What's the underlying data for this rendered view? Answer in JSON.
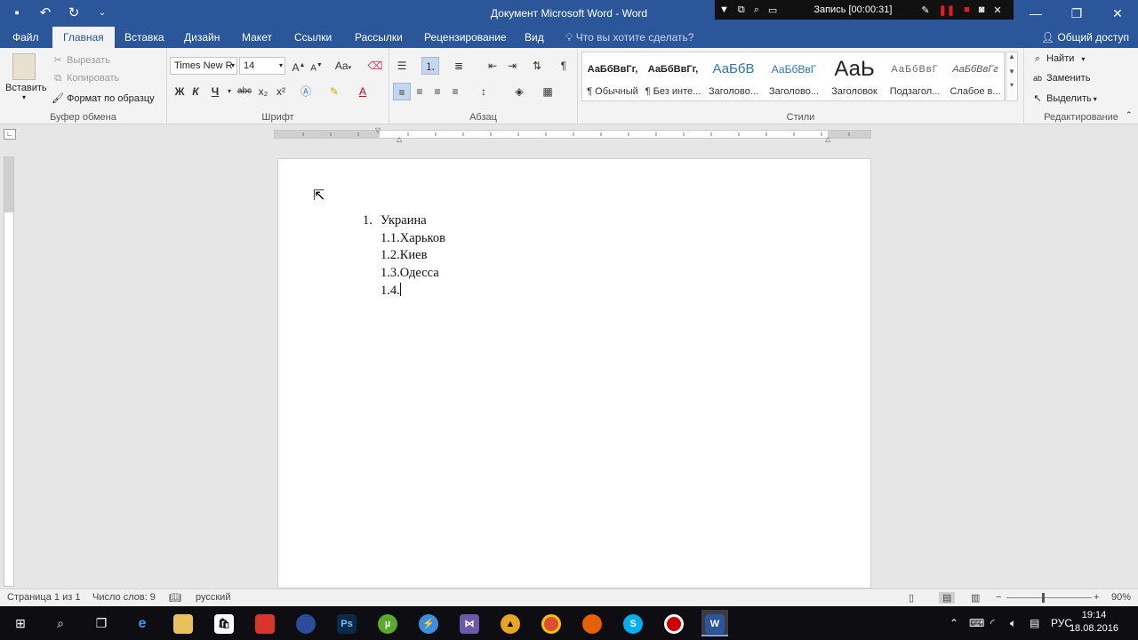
{
  "titlebar": {
    "title": "Документ Microsoft Word - Word",
    "quick_access": [
      {
        "icon": "save-icon",
        "glyph": "💾"
      },
      {
        "icon": "undo-icon",
        "glyph": "↶"
      },
      {
        "icon": "redo-icon",
        "glyph": "↻"
      },
      {
        "icon": "customize-icon",
        "glyph": "⌄"
      }
    ],
    "window_controls": [
      {
        "icon": "ribbon-options-icon",
        "glyph": "▣"
      },
      {
        "icon": "minimize-icon",
        "glyph": "—"
      },
      {
        "icon": "restore-icon",
        "glyph": "❐"
      },
      {
        "icon": "close-icon",
        "glyph": "✕"
      }
    ]
  },
  "recorder": {
    "label": "Запись [00:00:31]"
  },
  "tabs": {
    "items": [
      "Файл",
      "Главная",
      "Вставка",
      "Дизайн",
      "Макет",
      "Ссылки",
      "Рассылки",
      "Рецензирование",
      "Вид"
    ],
    "active": "Главная",
    "tell_me": "Что вы хотите сделать?",
    "share": "Общий доступ"
  },
  "ribbon": {
    "clipboard": {
      "label": "Буфер обмена",
      "paste": "Вставить",
      "cut": "Вырезать",
      "copy": "Копировать",
      "format_painter": "Формат по образцу"
    },
    "font": {
      "label": "Шрифт",
      "font_name": "Times New R",
      "font_size": "14",
      "bold": "Ж",
      "italic": "К",
      "underline": "Ч",
      "strike": "abc",
      "subscript": "x₂",
      "superscript": "x²",
      "grow": "A",
      "shrink": "A",
      "change_case": "Aa"
    },
    "paragraph": {
      "label": "Абзац"
    },
    "styles": {
      "label": "Стили",
      "items": [
        {
          "sample": "АаБбВвГг,",
          "name": "¶ Обычный"
        },
        {
          "sample": "АаБбВвГг,",
          "name": "¶ Без инте..."
        },
        {
          "sample": "АаБбВ",
          "name": "Заголово..."
        },
        {
          "sample": "АаБбВвГ",
          "name": "Заголово..."
        },
        {
          "sample": "АаЬ",
          "name": "Заголовок"
        },
        {
          "sample": "АаБбВвГ",
          "name": "Подзагол..."
        },
        {
          "sample": "АаБбВвГг",
          "name": "Слабое в..."
        }
      ]
    },
    "editing": {
      "label": "Редактирование",
      "find": "Найти",
      "replace": "Заменить",
      "select": "Выделить"
    }
  },
  "document": {
    "lines": [
      {
        "num": "1.",
        "text": "Украина"
      },
      {
        "num": "",
        "text": "1.1.Харьков"
      },
      {
        "num": "",
        "text": "1.2.Киев"
      },
      {
        "num": "",
        "text": "1.3.Одесса"
      },
      {
        "num": "",
        "text": "1.4."
      }
    ]
  },
  "statusbar": {
    "page": "Страница 1 из 1",
    "words": "Число слов: 9",
    "language": "русский",
    "zoom": "90%"
  },
  "taskbar": {
    "apps": [
      {
        "icon": "windows-start-icon"
      },
      {
        "icon": "search-icon"
      },
      {
        "icon": "task-view-icon"
      },
      {
        "icon": "edge-icon"
      },
      {
        "icon": "file-explorer-icon"
      },
      {
        "icon": "store-icon"
      },
      {
        "icon": "app-icon"
      },
      {
        "icon": "app-icon"
      },
      {
        "icon": "photoshop-icon",
        "text": "Ps"
      },
      {
        "icon": "utorrent-icon"
      },
      {
        "icon": "app-icon"
      },
      {
        "icon": "app-icon"
      },
      {
        "icon": "app-icon"
      },
      {
        "icon": "chrome-icon"
      },
      {
        "icon": "firefox-icon"
      },
      {
        "icon": "skype-icon"
      },
      {
        "icon": "recorder-icon"
      },
      {
        "icon": "word-icon",
        "text": "W"
      }
    ],
    "language": "РУС",
    "time": "19:14",
    "date": "18.08.2016"
  }
}
